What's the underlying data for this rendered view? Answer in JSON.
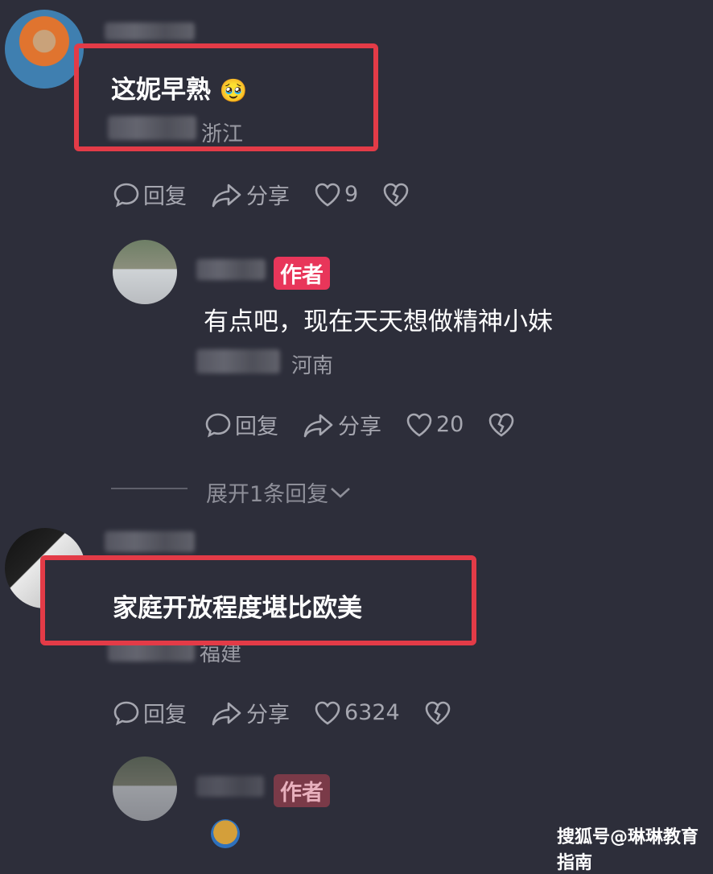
{
  "comments": [
    {
      "text": "这妮早熟",
      "emoji": "🥹",
      "location": "浙江",
      "actions": {
        "reply": "回复",
        "share": "分享",
        "likes": "9"
      }
    },
    {
      "is_author": true,
      "badge": "作者",
      "text": "有点吧，现在天天想做精神小妹",
      "location": "河南",
      "actions": {
        "reply": "回复",
        "share": "分享",
        "likes": "20"
      }
    },
    {
      "expand_label": "展开1条回复"
    },
    {
      "text": "家庭开放程度堪比欧美",
      "location": "福建",
      "actions": {
        "reply": "回复",
        "share": "分享",
        "likes": "6324"
      }
    },
    {
      "is_author": true,
      "badge": "作者"
    }
  ],
  "watermark": "搜狐号@琳琳教育指南",
  "colors": {
    "background": "#2d2e3a",
    "highlight": "#e33b47",
    "badge": "#e8365a"
  }
}
